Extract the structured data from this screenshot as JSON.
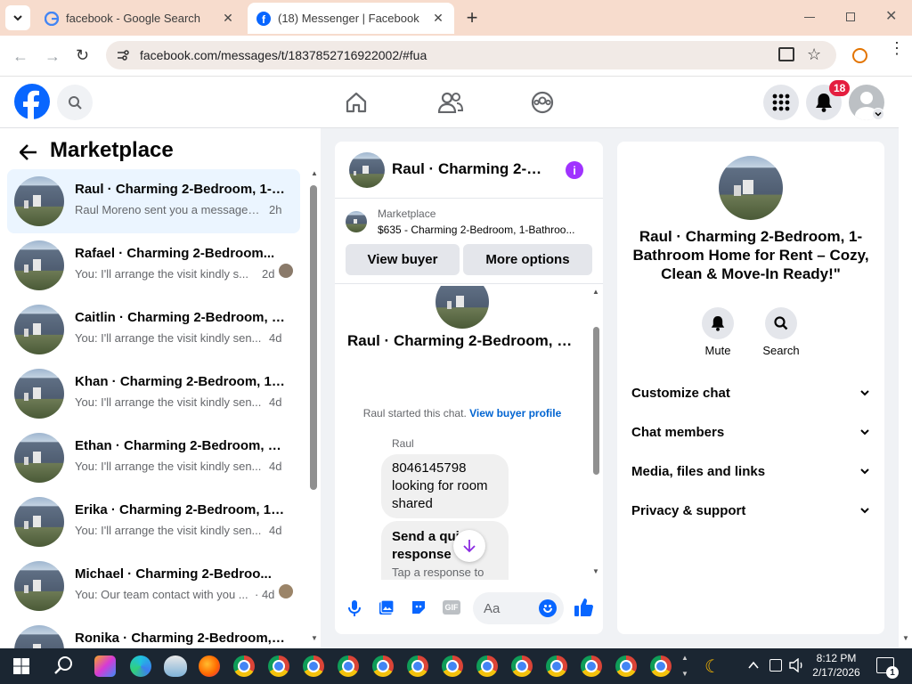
{
  "browser": {
    "tabs": [
      {
        "title": "facebook - Google Search"
      },
      {
        "title": "(18) Messenger | Facebook"
      }
    ],
    "url": "facebook.com/messages/t/1837852716922002/#fua"
  },
  "header": {
    "notification_count": "18"
  },
  "sidebar": {
    "title": "Marketplace",
    "conversations": [
      {
        "name": "Raul · Charming 2-Bedroom, 1-B...",
        "preview": "Raul Moreno sent you a message a...",
        "time": "2h"
      },
      {
        "name": "Rafael · Charming 2-Bedroom...",
        "preview": "You: I'll arrange the visit kindly s...",
        "time": "2d"
      },
      {
        "name": "Caitlin · Charming 2-Bedroom, 1...",
        "preview": "You: I'll arrange the visit kindly sen...",
        "time": "4d"
      },
      {
        "name": "Khan · Charming 2-Bedroom, 1-...",
        "preview": "You: I'll arrange the visit kindly sen...",
        "time": "4d"
      },
      {
        "name": "Ethan · Charming 2-Bedroom, 1-...",
        "preview": "You: I'll arrange the visit kindly sen...",
        "time": "4d"
      },
      {
        "name": "Erika · Charming 2-Bedroom, 1-...",
        "preview": "You: I'll arrange the visit kindly sen...",
        "time": "4d"
      },
      {
        "name": "Michael · Charming 2-Bedroo...",
        "preview": "You: Our team contact with you ...",
        "time": "· 4d"
      },
      {
        "name": "Ronika · Charming 2-Bedroom, 1...",
        "preview": "",
        "time": ""
      }
    ]
  },
  "chat": {
    "header_title": "Raul · Charming 2-Be...",
    "listing_label": "Marketplace",
    "listing_detail": "$635 - Charming 2-Bedroom, 1-Bathroo...",
    "view_buyer": "View buyer",
    "more_options": "More options",
    "profile_name": "Raul · Charming 2-Bedroom, 1-...",
    "started_text": "Raul started this chat.",
    "view_buyer_profile": "View buyer profile",
    "sender": "Raul",
    "message": "8046145798 looking for room shared",
    "quick_title": "Send a quick response",
    "quick_sub": "Tap a response to",
    "composer_placeholder": "Aa"
  },
  "info": {
    "title": "Raul · Charming 2-Bedroom, 1-Bathroom Home for Rent – Cozy, Clean & Move-In Ready!\"",
    "mute": "Mute",
    "search": "Search",
    "sections": [
      "Customize chat",
      "Chat members",
      "Media, files and links",
      "Privacy & support"
    ]
  },
  "taskbar": {
    "time": "8:12 PM",
    "date": "2/17/2026",
    "notif": "1"
  },
  "colors": {
    "fb_blue": "#0866ff",
    "accent_purple": "#a033ff",
    "badge_red": "#e41e3f"
  }
}
